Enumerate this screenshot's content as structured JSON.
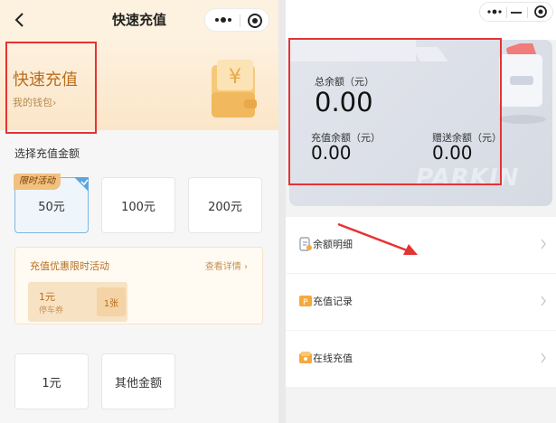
{
  "left_screen": {
    "nav": {
      "title": "快速充值"
    },
    "banner": {
      "title": "快速充值",
      "wallet_link": "我的钱包›",
      "wallet_symbol": "¥"
    },
    "choose_label": "选择充值金额",
    "promo_tag": "限时活动",
    "amounts_row1": [
      "50元",
      "100元",
      "200元"
    ],
    "promo": {
      "title": "充值优惠限时活动",
      "more": "查看详情 ›",
      "coupon": {
        "amount": "1元",
        "name": "停车券",
        "count": "1张"
      }
    },
    "amounts_row2": [
      "1元",
      "其他金额"
    ]
  },
  "right_screen": {
    "card": {
      "total_label": "总余额（元）",
      "total_value": "0.00",
      "recharge_label": "充值余额（元）",
      "recharge_value": "0.00",
      "gift_label": "赠送余额（元）",
      "gift_value": "0.00",
      "watermark": "PARKIN"
    },
    "menu": [
      {
        "label": "余额明细",
        "icon": "receipt-icon"
      },
      {
        "label": "充值记录",
        "icon": "recharge-record-icon"
      },
      {
        "label": "在线充值",
        "icon": "wallet-icon"
      }
    ]
  },
  "colors": {
    "highlight_box": "#e53333",
    "accent_gold": "#b86e1d",
    "selected_blue": "#7fb8e3"
  }
}
